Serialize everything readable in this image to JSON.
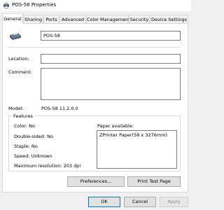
{
  "window": {
    "title": "POS-58 Properties"
  },
  "tabs": [
    {
      "label": "General"
    },
    {
      "label": "Sharing"
    },
    {
      "label": "Ports"
    },
    {
      "label": "Advanced"
    },
    {
      "label": "Color Management"
    },
    {
      "label": "Security"
    },
    {
      "label": "Device Settings"
    }
  ],
  "general": {
    "printer_name": "POS-58",
    "location_label": "Location:",
    "location_value": "",
    "comment_label": "Comment:",
    "comment_value": "",
    "model_label": "Model:",
    "model_value": "POS-58 11.2.0.0"
  },
  "features": {
    "title": "Features",
    "color": "Color: No",
    "double_sided": "Double-sided: No",
    "staple": "Staple: No",
    "speed": "Speed: Unknown",
    "max_resolution": "Maximum resolution: 203 dpi",
    "paper_available_label": "Paper available:",
    "paper_list": [
      "ZPrinter Paper(58 x 3276mm)"
    ]
  },
  "buttons": {
    "preferences": "Preferences...",
    "print_test": "Print Test Page",
    "ok": "OK",
    "cancel": "Cancel",
    "apply": "Apply"
  }
}
